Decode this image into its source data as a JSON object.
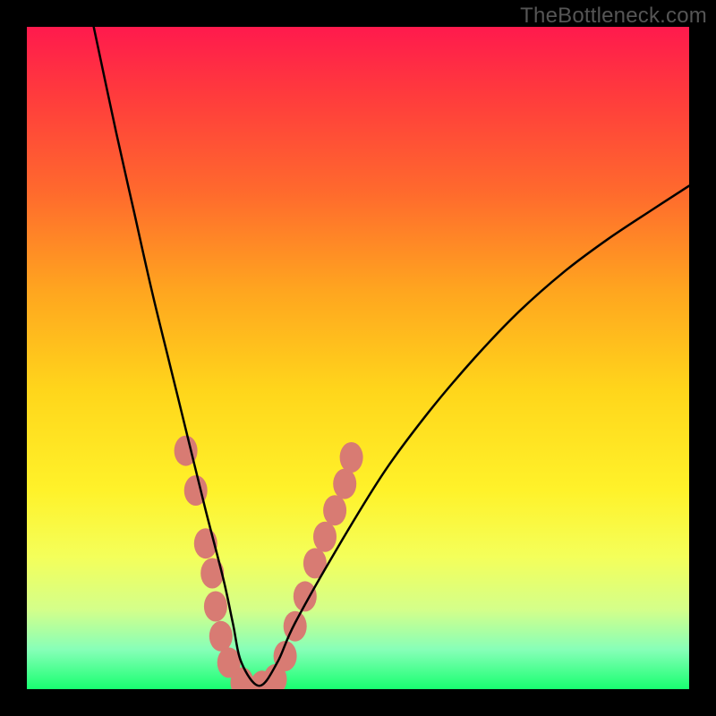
{
  "watermark": "TheBottleneck.com",
  "colors": {
    "background": "#000000",
    "gradient_top": "#ff1a4d",
    "gradient_bottom": "#18ff70",
    "curve": "#000000",
    "blobs": "#d87b73"
  },
  "chart_data": {
    "type": "line",
    "title": "",
    "xlabel": "",
    "ylabel": "",
    "xlim": [
      0,
      100
    ],
    "ylim": [
      0,
      100
    ],
    "grid": false,
    "note": "No axes/ticks shown; values estimated from pixel positions on 740x740 plot (origin at top-left, x right, y down). Lower y ~ bottom of plot.",
    "series": [
      {
        "name": "bottleneck-curve",
        "x": [
          10.1,
          13.5,
          16.2,
          18.9,
          21.6,
          24.3,
          27.0,
          29.7,
          31.1,
          32.4,
          35.1,
          37.8,
          40.5,
          47.3,
          54.1,
          60.8,
          67.6,
          74.3,
          81.1,
          87.8,
          94.6,
          100.0
        ],
        "y": [
          100.0,
          84.0,
          72.0,
          60.0,
          49.0,
          38.0,
          27.0,
          16.5,
          10.0,
          4.0,
          0.5,
          4.0,
          10.0,
          22.0,
          33.0,
          42.0,
          50.0,
          57.0,
          63.0,
          68.0,
          72.5,
          76.0
        ]
      }
    ],
    "annotations": {
      "blobs_note": "Pink oval markers overlaid near the curve valley; positions in same 0-100 coords.",
      "blobs": [
        {
          "x": 24.0,
          "y": 36.0
        },
        {
          "x": 25.5,
          "y": 30.0
        },
        {
          "x": 27.0,
          "y": 22.0
        },
        {
          "x": 28.0,
          "y": 17.5
        },
        {
          "x": 28.5,
          "y": 12.5
        },
        {
          "x": 29.3,
          "y": 8.0
        },
        {
          "x": 30.5,
          "y": 4.0
        },
        {
          "x": 32.5,
          "y": 1.0
        },
        {
          "x": 35.5,
          "y": 0.5
        },
        {
          "x": 37.5,
          "y": 1.5
        },
        {
          "x": 39.0,
          "y": 5.0
        },
        {
          "x": 40.5,
          "y": 9.5
        },
        {
          "x": 42.0,
          "y": 14.0
        },
        {
          "x": 43.5,
          "y": 19.0
        },
        {
          "x": 45.0,
          "y": 23.0
        },
        {
          "x": 46.5,
          "y": 27.0
        },
        {
          "x": 48.0,
          "y": 31.0
        },
        {
          "x": 49.0,
          "y": 35.0
        }
      ]
    }
  }
}
